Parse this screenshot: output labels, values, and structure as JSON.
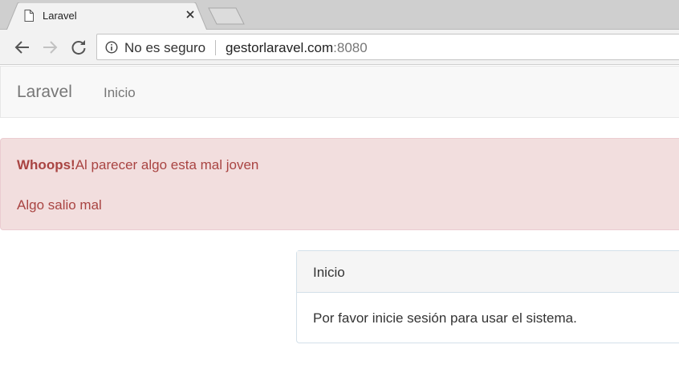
{
  "browser": {
    "tab_title": "Laravel",
    "security_label": "No es seguro",
    "url_host": "gestorlaravel.com",
    "url_port": ":8080"
  },
  "navbar": {
    "brand": "Laravel",
    "links": [
      "Inicio"
    ]
  },
  "alert": {
    "strong": "Whoops!",
    "message": "Al parecer algo esta mal joven",
    "error": "Algo salio mal"
  },
  "panel": {
    "heading": "Inicio",
    "body": "Por favor inicie sesión para usar el sistema."
  },
  "colors": {
    "alert_bg": "#f2dede",
    "alert_text": "#a94442",
    "navbar_bg": "#f8f8f8",
    "panel_heading_bg": "#f5f5f5"
  },
  "icons": [
    "page-icon",
    "close-icon",
    "back-arrow-icon",
    "forward-arrow-icon",
    "reload-icon",
    "info-icon"
  ]
}
